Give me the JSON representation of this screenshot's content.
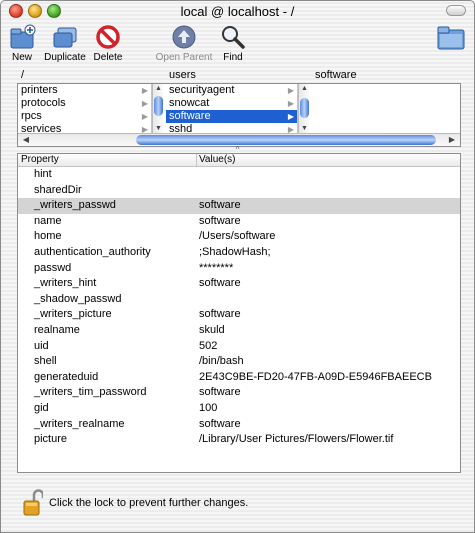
{
  "window": {
    "title": "local @ localhost - /"
  },
  "toolbar": {
    "new_label": "New",
    "duplicate_label": "Duplicate",
    "delete_label": "Delete",
    "open_parent_label": "Open Parent",
    "find_label": "Find"
  },
  "browser": {
    "columns": [
      "/",
      "users",
      "software"
    ],
    "col1_items": [
      "printers",
      "protocols",
      "rpcs",
      "services"
    ],
    "col2_items": [
      "securityagent",
      "snowcat",
      "software",
      "sshd"
    ],
    "col2_selected": "software"
  },
  "table": {
    "headers": {
      "property": "Property",
      "values": "Value(s)"
    },
    "rows": [
      {
        "property": "hint",
        "value": ""
      },
      {
        "property": "sharedDir",
        "value": ""
      },
      {
        "property": "_writers_passwd",
        "value": "software"
      },
      {
        "property": "name",
        "value": "software"
      },
      {
        "property": "home",
        "value": "/Users/software"
      },
      {
        "property": "authentication_authority",
        "value": ";ShadowHash;"
      },
      {
        "property": "passwd",
        "value": "********"
      },
      {
        "property": "_writers_hint",
        "value": "software"
      },
      {
        "property": "_shadow_passwd",
        "value": ""
      },
      {
        "property": "_writers_picture",
        "value": "software"
      },
      {
        "property": "realname",
        "value": "skuld"
      },
      {
        "property": "uid",
        "value": "502"
      },
      {
        "property": "shell",
        "value": "/bin/bash"
      },
      {
        "property": "generateduid",
        "value": "2E43C9BE-FD20-47FB-A09D-E5946FBAEECB"
      },
      {
        "property": "_writers_tim_password",
        "value": "software"
      },
      {
        "property": "gid",
        "value": "100"
      },
      {
        "property": "_writers_realname",
        "value": "software"
      },
      {
        "property": "picture",
        "value": "/Library/User Pictures/Flowers/Flower.tif"
      }
    ],
    "selected_row": "_writers_passwd"
  },
  "lock": {
    "text": "Click the lock to prevent further changes."
  },
  "colors": {
    "selection": "#1e5fd1",
    "row_highlight": "#d4d4d4"
  },
  "icons": [
    "new-icon",
    "duplicate-icon",
    "delete-icon",
    "open-parent-icon",
    "find-icon",
    "folder-icon",
    "lock-icon"
  ]
}
